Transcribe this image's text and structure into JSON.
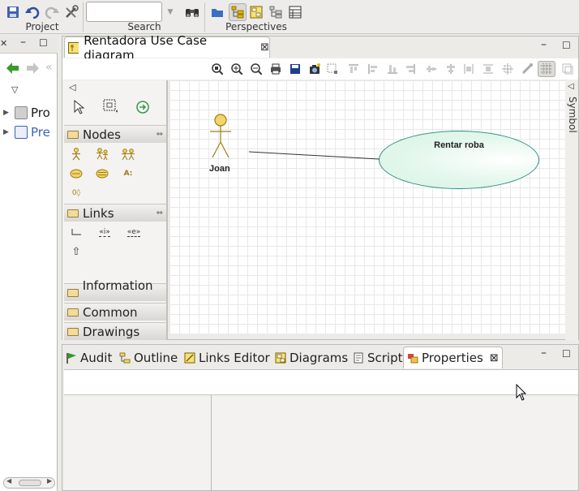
{
  "toolbar": {
    "groups": {
      "project": "Project",
      "search": "Search",
      "perspectives": "Perspectives"
    },
    "search_value": ""
  },
  "left_view": {
    "tree": [
      {
        "label": "Pro",
        "color": "#1a1a1a"
      },
      {
        "label": "Pre",
        "color": "#3b62b5"
      }
    ]
  },
  "editor": {
    "tab_title": "Rentadora Use Case diagram",
    "palette": {
      "sections": {
        "nodes": "Nodes",
        "links": "Links",
        "information": "Information ...",
        "common": "Common",
        "drawings": "Drawings"
      },
      "link_tools": [
        "«i»",
        "«e»"
      ]
    },
    "diagram": {
      "actor": "Joan",
      "use_case": "Rentar roba"
    },
    "symbol_strip": "Symbol"
  },
  "bottom": {
    "tabs": [
      {
        "label": "Audit",
        "icon": "flag-icon"
      },
      {
        "label": "Outline",
        "icon": "outline-icon"
      },
      {
        "label": "Links Editor",
        "icon": "links-editor-icon"
      },
      {
        "label": "Diagrams",
        "icon": "diagrams-icon"
      },
      {
        "label": "Script",
        "icon": "script-icon"
      },
      {
        "label": "Properties",
        "icon": "properties-icon",
        "active": true
      }
    ]
  },
  "colors": {
    "use_case_stroke": "#2a8c86",
    "use_case_fill": "#d8f3e4",
    "actor_color": "#c9a646"
  }
}
